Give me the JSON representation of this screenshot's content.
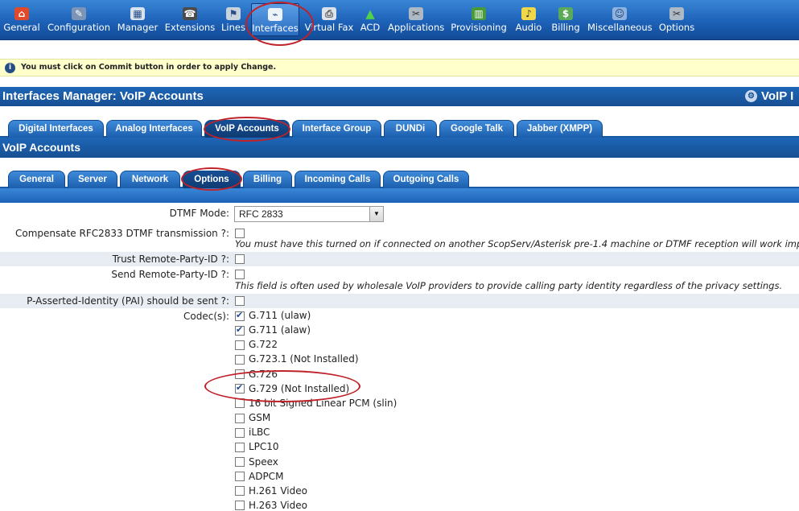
{
  "toolbar": {
    "items": [
      {
        "label": "General",
        "icon": "home-icon"
      },
      {
        "label": "Configuration",
        "icon": "wrench-icon"
      },
      {
        "label": "Manager",
        "icon": "calendar-icon"
      },
      {
        "label": "Extensions",
        "icon": "phone-icon"
      },
      {
        "label": "Lines",
        "icon": "flag-icon"
      },
      {
        "label": "Interfaces",
        "icon": "plug-icon"
      },
      {
        "label": "Virtual Fax",
        "icon": "fax-icon"
      },
      {
        "label": "ACD",
        "icon": "triangle-icon"
      },
      {
        "label": "Applications",
        "icon": "tools-icon"
      },
      {
        "label": "Provisioning",
        "icon": "chart-icon"
      },
      {
        "label": "Audio",
        "icon": "speaker-icon"
      },
      {
        "label": "Billing",
        "icon": "money-icon"
      },
      {
        "label": "Miscellaneous",
        "icon": "group-icon"
      },
      {
        "label": "Options",
        "icon": "tools-icon"
      }
    ],
    "active": "Interfaces"
  },
  "notice": {
    "text": "You must click on Commit button in order to apply Change."
  },
  "header": {
    "title": "Interfaces Manager:  VoIP Accounts",
    "right_title": "VoIP I"
  },
  "tabs_primary": [
    "Digital Interfaces",
    "Analog Interfaces",
    "VoIP Accounts",
    "Interface Group",
    "DUNDi",
    "Google Talk",
    "Jabber (XMPP)"
  ],
  "section_title": "VoIP Accounts",
  "tabs_secondary": [
    "General",
    "Server",
    "Network",
    "Options",
    "Billing",
    "Incoming Calls",
    "Outgoing Calls"
  ],
  "form": {
    "dtmf": {
      "label": "DTMF Mode:",
      "value": "RFC 2833"
    },
    "compensate": {
      "label": "Compensate RFC2833 DTMF transmission ?:",
      "checked": false,
      "note": "You must have this turned on if connected on another ScopServ/Asterisk pre-1.4 machine or DTMF reception will work improperly."
    },
    "trust_rpid": {
      "label": "Trust Remote-Party-ID ?:",
      "checked": false
    },
    "send_rpid": {
      "label": "Send Remote-Party-ID ?:",
      "checked": false,
      "note": "This field is often used by wholesale VoIP providers to provide calling party identity regardless of the privacy settings."
    },
    "pai": {
      "label": "P-Asserted-Identity (PAI) should be sent ?:",
      "checked": false
    },
    "codecs_label": "Codec(s):",
    "codecs": [
      {
        "name": "G.711 (ulaw)",
        "checked": true
      },
      {
        "name": "G.711 (alaw)",
        "checked": true
      },
      {
        "name": "G.722",
        "checked": false
      },
      {
        "name": "G.723.1 (Not Installed)",
        "checked": false
      },
      {
        "name": "G.726",
        "checked": false
      },
      {
        "name": "G.729 (Not Installed)",
        "checked": true
      },
      {
        "name": "16 bit Signed Linear PCM (slin)",
        "checked": false
      },
      {
        "name": "GSM",
        "checked": false
      },
      {
        "name": "iLBC",
        "checked": false
      },
      {
        "name": "LPC10",
        "checked": false
      },
      {
        "name": "Speex",
        "checked": false
      },
      {
        "name": "ADPCM",
        "checked": false
      },
      {
        "name": "H.261 Video",
        "checked": false
      },
      {
        "name": "H.263 Video",
        "checked": false
      }
    ]
  },
  "colors": {
    "toolbar_blue": "#1d62b8",
    "title_blue": "#164f92",
    "annotation_red": "#c0222a",
    "notice_yellow": "#ffffcc"
  }
}
